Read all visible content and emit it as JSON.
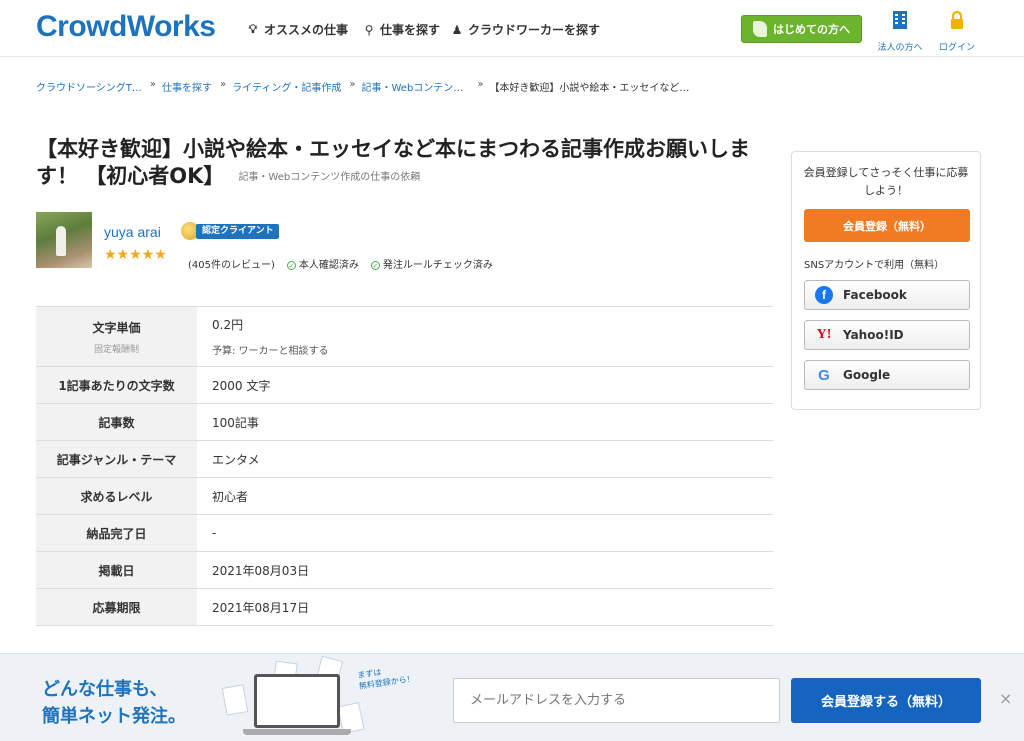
{
  "header": {
    "logo": "CrowdWorks",
    "nav": [
      {
        "label": "オススメの仕事",
        "icon": "lightbulb-icon"
      },
      {
        "label": "仕事を探す",
        "icon": "search-icon"
      },
      {
        "label": "クラウドワーカーを探す",
        "icon": "users-icon"
      }
    ],
    "first_time_button": "はじめての方へ",
    "corporate_link": "法人の方へ",
    "login_link": "ログイン"
  },
  "breadcrumb": [
    "クラウドソーシングT…",
    "仕事を探す",
    "ライティング・記事作成",
    "記事・Webコンテン…",
    "【本好き歓迎】小説や絵本・エッセイなど…"
  ],
  "breadcrumb_sep": "»",
  "job": {
    "title": "【本好き歓迎】小説や絵本・エッセイなど本にまつわる記事作成お願いします！ 【初心者OK】",
    "category": "記事・Webコンテンツ作成の仕事の依頼"
  },
  "client": {
    "name": "yuya arai",
    "badge": "認定クライアント",
    "stars": "★★★★★",
    "rating": 5,
    "reviews": "(405件のレビュー)",
    "identity_verified": "本人確認済み",
    "rule_checked": "発注ルールチェック済み"
  },
  "details": [
    {
      "label": "文字単価",
      "label_note": "固定報酬制",
      "value": "0.2円",
      "value_note": "予算: ワーカーと相談する"
    },
    {
      "label": "1記事あたりの文字数",
      "value": "2000 文字"
    },
    {
      "label": "記事数",
      "value": "100記事"
    },
    {
      "label": "記事ジャンル・テーマ",
      "value": "エンタメ"
    },
    {
      "label": "求めるレベル",
      "value": "初心者"
    },
    {
      "label": "納品完了日",
      "value": "-"
    },
    {
      "label": "掲載日",
      "value": "2021年08月03日"
    },
    {
      "label": "応募期限",
      "value": "2021年08月17日"
    }
  ],
  "side": {
    "lead": "会員登録してさっそく仕事に応募しよう！",
    "register_button": "会員登録（無料）",
    "sns_label": "SNSアカウントで利用（無料）",
    "facebook": "Facebook",
    "yahoo": "Yahoo!ID",
    "google": "Google"
  },
  "bottom_bar": {
    "catch_line1": "どんな仕事も、",
    "catch_line2": "簡単ネット発注。",
    "illustration_text_1": "まずは",
    "illustration_text_2": "無料登録から！",
    "email_placeholder": "メールアドレスを入力する",
    "submit_button": "会員登録する（無料）",
    "close_icon": "×"
  },
  "colors": {
    "brand_blue": "#1e73be",
    "orange": "#f07b22",
    "green": "#6cb42c",
    "star": "#f5a623"
  }
}
